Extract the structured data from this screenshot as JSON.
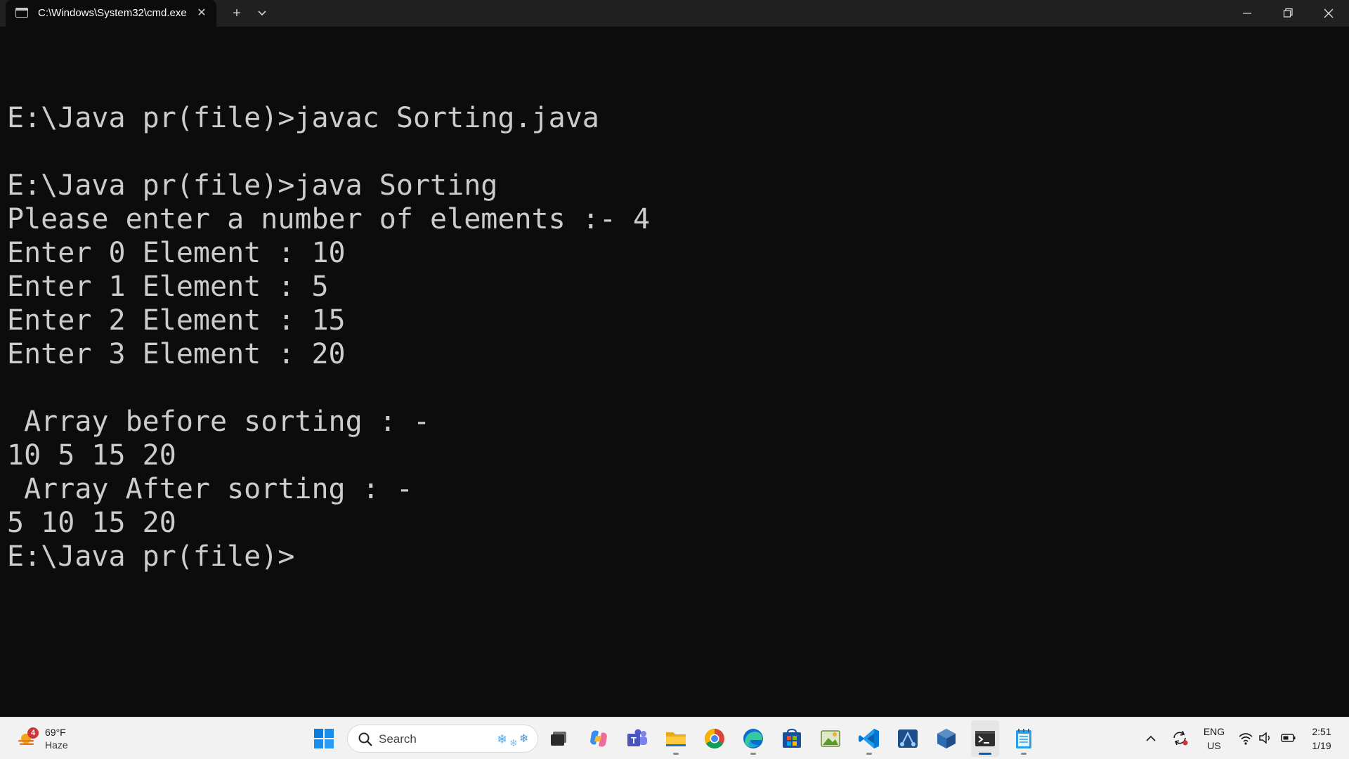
{
  "window": {
    "tab_title": "C:\\Windows\\System32\\cmd.exe",
    "tab_close_icon": "close-icon",
    "new_tab_label": "+",
    "dropdown_label": "⌄",
    "minimize_label": "—",
    "restore_label": "❐",
    "close_label": "✕"
  },
  "terminal": {
    "lines": [
      "",
      "E:\\Java pr(file)>javac Sorting.java",
      "",
      "E:\\Java pr(file)>java Sorting",
      "Please enter a number of elements :- 4",
      "Enter 0 Element : 10",
      "Enter 1 Element : 5",
      "Enter 2 Element : 15",
      "Enter 3 Element : 20",
      "",
      " Array before sorting : -",
      "10 5 15 20",
      " Array After sorting : -",
      "5 10 15 20",
      "E:\\Java pr(file)>"
    ]
  },
  "taskbar": {
    "weather": {
      "badge": "4",
      "temperature": "69°F",
      "condition": "Haze"
    },
    "search_placeholder": "Search",
    "apps": [
      "start-icon",
      "task-view-icon",
      "copilot-icon",
      "teams-icon",
      "file-explorer-icon",
      "chrome-icon",
      "edge-icon",
      "microsoft-store-icon",
      "photo-editor-icon",
      "vscode-icon",
      "snipping-tool-icon",
      "virtualbox-icon",
      "terminal-icon",
      "notepad-icon"
    ],
    "tray": {
      "language_line1": "ENG",
      "language_line2": "US",
      "time": "2:51",
      "date": "1/19"
    }
  },
  "colors": {
    "terminal_bg": "#0c0c0c",
    "terminal_fg": "#cccccc",
    "titlebar_bg": "#202020",
    "taskbar_bg": "#f2f2f2",
    "accent": "#005fb8"
  }
}
